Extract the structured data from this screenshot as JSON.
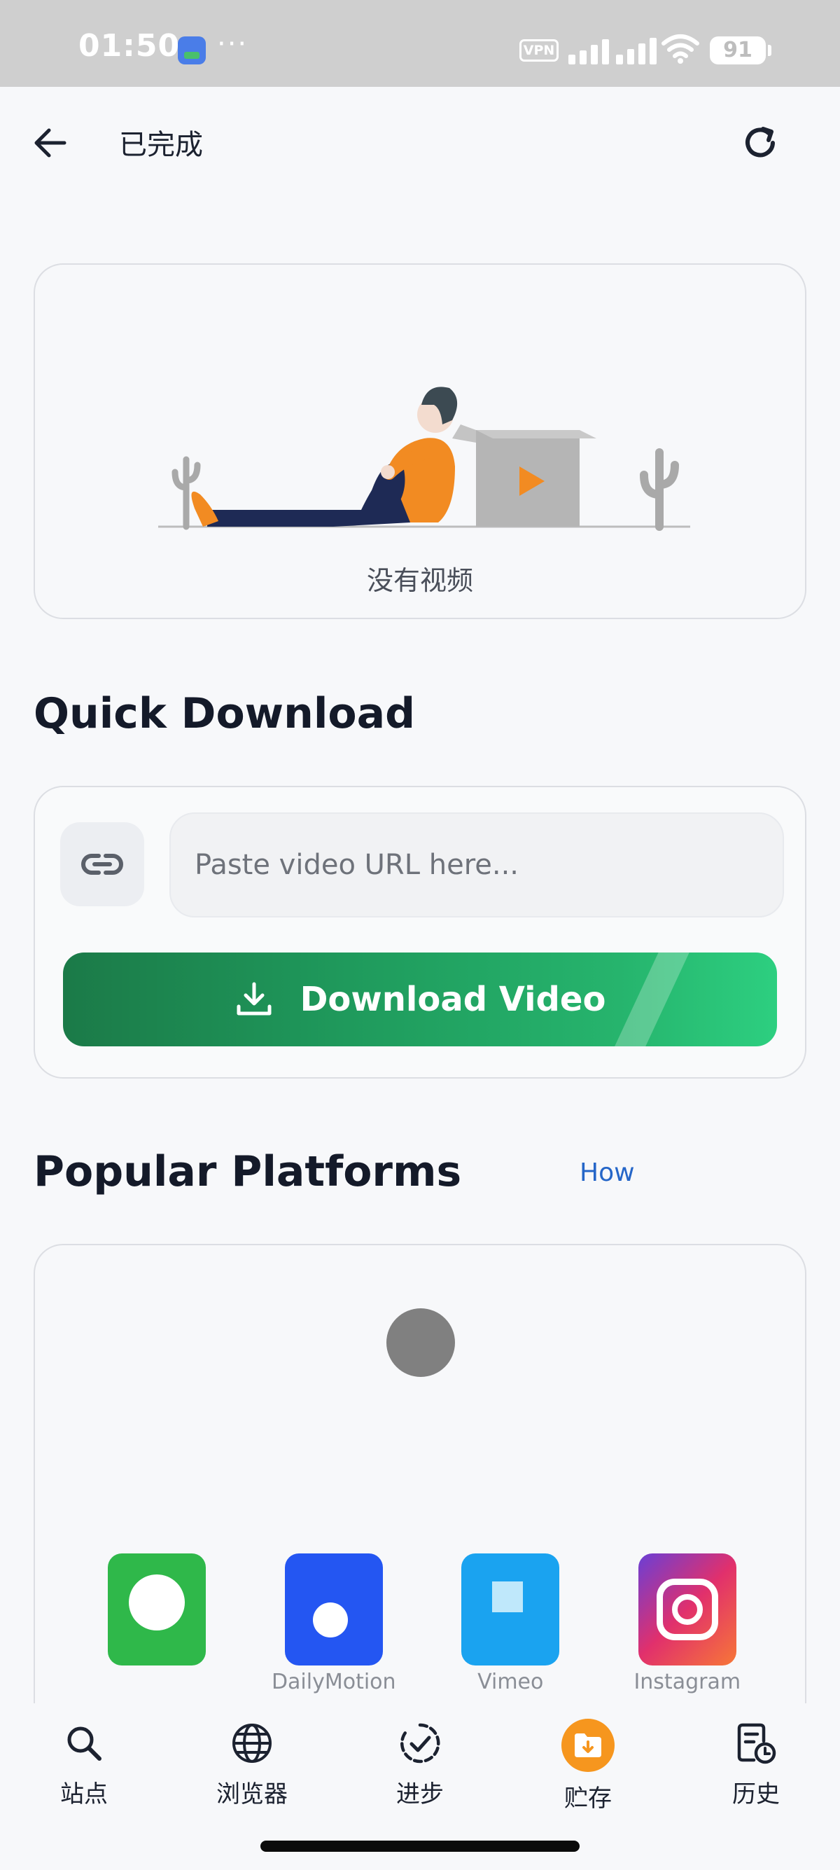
{
  "status_bar": {
    "time": "01:50",
    "overflow": "···",
    "vpn": "VPN",
    "battery": "91",
    "icons": [
      "app-notification-icon",
      "signal-icon",
      "wifi-icon",
      "battery-icon"
    ]
  },
  "app_bar": {
    "title": "已完成",
    "back_icon": "arrow-left-icon",
    "refresh_icon": "refresh-icon"
  },
  "empty_state": {
    "message": "没有视频"
  },
  "quick_download": {
    "title": "Quick Download",
    "url_placeholder": "Paste video URL here...",
    "url_value": "",
    "button_label": "Download Video",
    "colors": {
      "button_start": "#1b7a48",
      "button_end": "#2dcf80"
    }
  },
  "popular_platforms": {
    "title": "Popular Platforms",
    "how_link": "How",
    "platforms": [
      {
        "name": "",
        "color": "#2fb84a"
      },
      {
        "name": "DailyMotion",
        "color": "#2456f2"
      },
      {
        "name": "Vimeo",
        "color": "#1aa3f0"
      },
      {
        "name": "Instagram",
        "color": "#e1306c"
      }
    ]
  },
  "bottom_nav": {
    "items": [
      {
        "label": "站点",
        "icon": "search-icon",
        "active": false
      },
      {
        "label": "浏览器",
        "icon": "globe-icon",
        "active": false
      },
      {
        "label": "进步",
        "icon": "progress-check-icon",
        "active": false
      },
      {
        "label": "贮存",
        "icon": "folder-download-icon",
        "active": true
      },
      {
        "label": "历史",
        "icon": "history-icon",
        "active": false
      }
    ],
    "active_color": "#f6961e"
  }
}
